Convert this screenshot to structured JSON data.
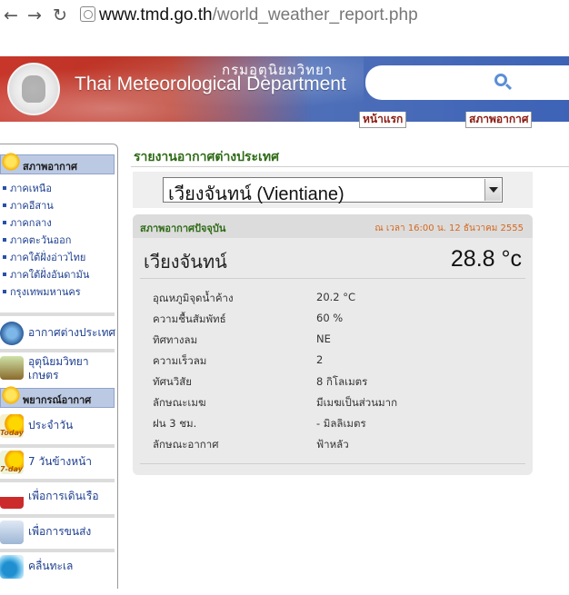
{
  "browser": {
    "url_host": "www.tmd.go.th",
    "url_path": "/world_weather_report.php"
  },
  "banner": {
    "org_thai": "กรมอุตุนิยมวิทยา",
    "org_en": "Thai Meteorological Department"
  },
  "top_links": {
    "home": "หน้าแรก",
    "weather": "สภาพอากาศ"
  },
  "sidebar": {
    "weather_header": "สภาพอากาศ",
    "regions": [
      "ภาคเหนือ",
      "ภาคอีสาน",
      "ภาคกลาง",
      "ภาคตะวันออก",
      "ภาคใต้ฝั่งอ่าวไทย",
      "ภาคใต้ฝั่งอันดามัน",
      "กรุงเทพมหานคร"
    ],
    "world_weather": "อากาศต่างประเทศ",
    "agri_line1": "อุตุนิยมวิทยา",
    "agri_line2": "เกษตร",
    "forecast_header": "พยากรณ์อากาศ",
    "today_badge": "Today",
    "daily": "ประจำวัน",
    "seven_day_badge": "7-day",
    "seven_day": "7 วันข้างหน้า",
    "shipping": "เพื่อการเดินเรือ",
    "aviation": "เพื่อการขนส่ง",
    "waves": "คลื่นทะเล"
  },
  "main": {
    "section_title": "รายงานอากาศต่างประเทศ",
    "selected_city": "เวียงจันทน์ (Vientiane)"
  },
  "report": {
    "header_label": "สภาพอากาศปัจจุบัน",
    "timestamp": "ณ เวลา 16:00 น. 12 ธันวาคม 2555",
    "city": "เวียงจันทน์",
    "temperature": "28.8 °c",
    "details": [
      {
        "label": "อุณหภูมิจุดน้ำค้าง",
        "value": "20.2 °C"
      },
      {
        "label": "ความชื้นสัมพัทธ์",
        "value": "60 %"
      },
      {
        "label": "ทิศทางลม",
        "value": "NE"
      },
      {
        "label": "ความเร็วลม",
        "value": "2"
      },
      {
        "label": "ทัศนวิสัย",
        "value": "8 กิโลเมตร"
      },
      {
        "label": "ลักษณะเมฆ",
        "value": "มีเมฆเป็นส่วนมาก"
      },
      {
        "label": "ฝน 3 ชม.",
        "value": "- มิลลิเมตร"
      },
      {
        "label": "ลักษณะอากาศ",
        "value": "ฟ้าหลัว"
      }
    ]
  }
}
